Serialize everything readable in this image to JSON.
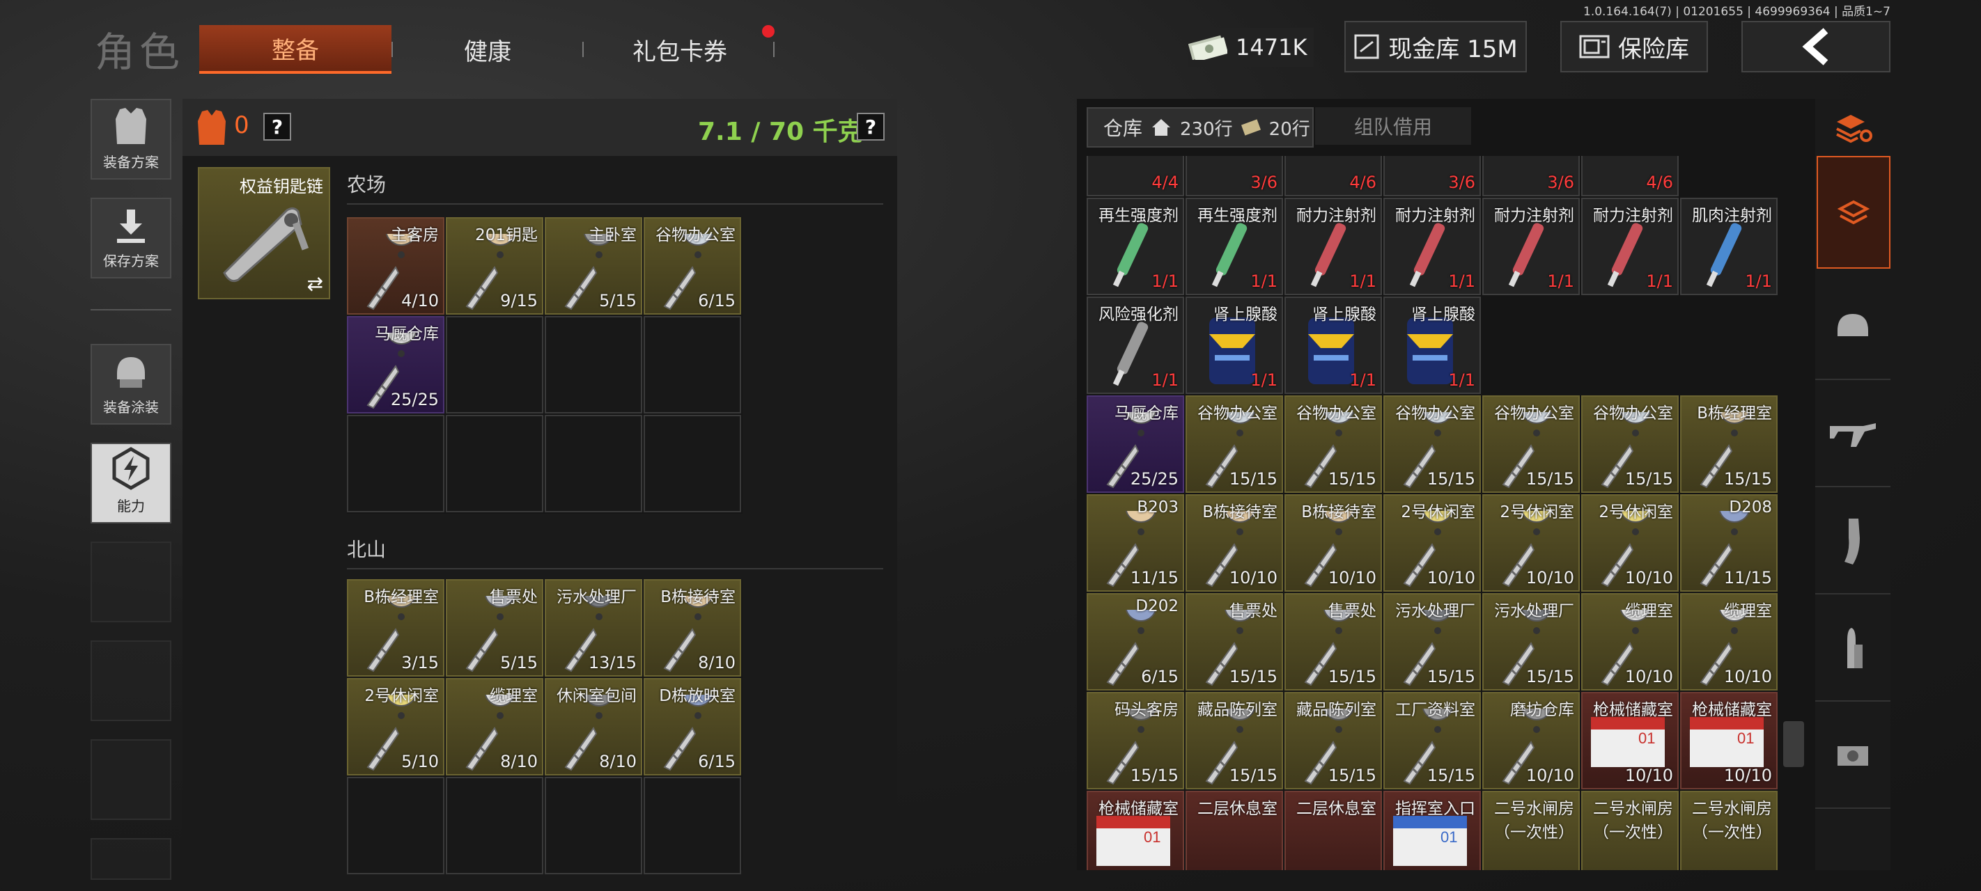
{
  "version": "1.0.164.164(7) | 01201655 | 4699969364 | 品质1~7",
  "page_title": "角色",
  "tabs": [
    {
      "label": "整备",
      "active": true
    },
    {
      "label": "健康",
      "active": false
    },
    {
      "label": "礼包卡券",
      "active": false,
      "badge": true
    }
  ],
  "top_bar": {
    "cash": "1471K",
    "vault_button": "现金库 15M",
    "safe_button": "保险库",
    "back_icon": "chevron-left-icon"
  },
  "left_rail": [
    {
      "label": "装备方案",
      "icon": "vest-icon"
    },
    {
      "label": "保存方案",
      "icon": "download-icon"
    },
    {
      "label": "装备涂装",
      "icon": "helmet-icon"
    },
    {
      "label": "能力",
      "icon": "lightning-icon",
      "active": true
    }
  ],
  "keychain": {
    "count": "0",
    "help": "?",
    "weight": "7.1 / 70 千克",
    "slot_label": "权益钥匙链",
    "swap_icon": "⇄"
  },
  "sections": [
    {
      "title": "农场",
      "items": [
        {
          "name": "主客房",
          "count": "4/10",
          "rarity": "brown",
          "color": "#e3c9a1"
        },
        {
          "name": "201钥匙",
          "count": "9/15",
          "rarity": "key",
          "color": "#e3c9a1"
        },
        {
          "name": "主卧室",
          "count": "5/15",
          "rarity": "key",
          "color": "#9a9a9a"
        },
        {
          "name": "谷物办公室",
          "count": "6/15",
          "rarity": "key",
          "color": "#cfd7de"
        },
        {
          "name": "马厩仓库",
          "count": "25/25",
          "rarity": "purple",
          "color": "#d8d8d8"
        }
      ]
    },
    {
      "title": "北山",
      "items": [
        {
          "name": "B栋经理室",
          "count": "3/15",
          "rarity": "key",
          "color": "#d8c4a0"
        },
        {
          "name": "售票处",
          "count": "5/15",
          "rarity": "key",
          "color": "#b9bcc2"
        },
        {
          "name": "污水处理厂",
          "count": "13/15",
          "rarity": "key",
          "color": "#7a7d82"
        },
        {
          "name": "B栋接待室",
          "count": "8/10",
          "rarity": "key",
          "color": "#e3c9a1"
        },
        {
          "name": "2号休闲室",
          "count": "5/10",
          "rarity": "key",
          "color": "#e8d87a"
        },
        {
          "name": "缆理室",
          "count": "8/10",
          "rarity": "key",
          "color": "#e0e0e0"
        },
        {
          "name": "休闲室包间",
          "count": "8/10",
          "rarity": "key",
          "color": "#8a8a8a"
        },
        {
          "name": "D栋放映室",
          "count": "6/15",
          "rarity": "key",
          "color": "#8fa0c8"
        }
      ]
    }
  ],
  "warehouse": {
    "tab_label": "仓库",
    "rows_total": "230行",
    "rows_extra": "20行",
    "team_tab": "组队借用",
    "rows": [
      [
        {
          "name": "",
          "count": "4/4",
          "rarity": "dark",
          "red": true,
          "kind": "bag"
        },
        {
          "name": "",
          "count": "3/6",
          "rarity": "dark",
          "red": true,
          "kind": "can"
        },
        {
          "name": "",
          "count": "4/6",
          "rarity": "dark",
          "red": true,
          "kind": "can"
        },
        {
          "name": "",
          "count": "3/6",
          "rarity": "dark",
          "red": true,
          "kind": "can"
        },
        {
          "name": "",
          "count": "3/6",
          "rarity": "dark",
          "red": true,
          "kind": "can"
        },
        {
          "name": "",
          "count": "4/6",
          "rarity": "dark",
          "red": true,
          "kind": "can"
        }
      ],
      [
        {
          "name": "再生强度剂",
          "count": "1/1",
          "rarity": "dark",
          "red": true,
          "kind": "syringe",
          "color": "#5fb87a"
        },
        {
          "name": "再生强度剂",
          "count": "1/1",
          "rarity": "dark",
          "red": true,
          "kind": "syringe",
          "color": "#5fb87a"
        },
        {
          "name": "耐力注射剂",
          "count": "1/1",
          "rarity": "dark",
          "red": true,
          "kind": "syringe",
          "color": "#c8525a"
        },
        {
          "name": "耐力注射剂",
          "count": "1/1",
          "rarity": "dark",
          "red": true,
          "kind": "syringe",
          "color": "#c8525a"
        },
        {
          "name": "耐力注射剂",
          "count": "1/1",
          "rarity": "dark",
          "red": true,
          "kind": "syringe",
          "color": "#c8525a"
        },
        {
          "name": "耐力注射剂",
          "count": "1/1",
          "rarity": "dark",
          "red": true,
          "kind": "syringe",
          "color": "#c8525a"
        },
        {
          "name": "肌肉注射剂",
          "count": "1/1",
          "rarity": "dark",
          "red": true,
          "kind": "syringe",
          "color": "#4a8ad0"
        }
      ],
      [
        {
          "name": "风险强化剂",
          "count": "1/1",
          "rarity": "dark",
          "red": true,
          "kind": "syringe",
          "color": "#999"
        },
        {
          "name": "肾上腺酸",
          "count": "1/1",
          "rarity": "dark",
          "red": true,
          "kind": "canblue"
        },
        {
          "name": "肾上腺酸",
          "count": "1/1",
          "rarity": "dark",
          "red": true,
          "kind": "canblue"
        },
        {
          "name": "肾上腺酸",
          "count": "1/1",
          "rarity": "dark",
          "red": true,
          "kind": "canblue"
        }
      ],
      [
        {
          "name": "马厩仓库",
          "count": "25/25",
          "rarity": "purple",
          "kind": "key",
          "color": "#d8d8d8"
        },
        {
          "name": "谷物办公室",
          "count": "15/15",
          "rarity": "key",
          "kind": "key",
          "color": "#cfd7de"
        },
        {
          "name": "谷物办公室",
          "count": "15/15",
          "rarity": "key",
          "kind": "key",
          "color": "#cfd7de"
        },
        {
          "name": "谷物办公室",
          "count": "15/15",
          "rarity": "key",
          "kind": "key",
          "color": "#cfd7de"
        },
        {
          "name": "谷物办公室",
          "count": "15/15",
          "rarity": "key",
          "kind": "key",
          "color": "#cfd7de"
        },
        {
          "name": "谷物办公室",
          "count": "15/15",
          "rarity": "key",
          "kind": "key",
          "color": "#cfd7de"
        },
        {
          "name": "B栋经理室",
          "count": "15/15",
          "rarity": "key",
          "kind": "key",
          "color": "#d8c4a0"
        }
      ],
      [
        {
          "name": "B203",
          "count": "11/15",
          "rarity": "key",
          "kind": "key",
          "color": "#e3c9a1"
        },
        {
          "name": "B栋接待室",
          "count": "10/10",
          "rarity": "key",
          "kind": "key",
          "color": "#e3c9a1"
        },
        {
          "name": "B栋接待室",
          "count": "10/10",
          "rarity": "key",
          "kind": "key",
          "color": "#e3c9a1"
        },
        {
          "name": "2号休闲室",
          "count": "10/10",
          "rarity": "key",
          "kind": "key",
          "color": "#e8d87a"
        },
        {
          "name": "2号休闲室",
          "count": "10/10",
          "rarity": "key",
          "kind": "key",
          "color": "#e8d87a"
        },
        {
          "name": "2号休闲室",
          "count": "10/10",
          "rarity": "key",
          "kind": "key",
          "color": "#e8d87a"
        },
        {
          "name": "D208",
          "count": "11/15",
          "rarity": "key",
          "kind": "key",
          "color": "#8fa0c8"
        }
      ],
      [
        {
          "name": "D202",
          "count": "6/15",
          "rarity": "key",
          "kind": "key",
          "color": "#8fa0c8"
        },
        {
          "name": "售票处",
          "count": "15/15",
          "rarity": "key",
          "kind": "key",
          "color": "#b9bcc2"
        },
        {
          "name": "售票处",
          "count": "15/15",
          "rarity": "key",
          "kind": "key",
          "color": "#b9bcc2"
        },
        {
          "name": "污水处理厂",
          "count": "15/15",
          "rarity": "key",
          "kind": "key",
          "color": "#7a7d82"
        },
        {
          "name": "污水处理厂",
          "count": "15/15",
          "rarity": "key",
          "kind": "key",
          "color": "#7a7d82"
        },
        {
          "name": "缆理室",
          "count": "10/10",
          "rarity": "key",
          "kind": "key",
          "color": "#e0e0e0"
        },
        {
          "name": "缆理室",
          "count": "10/10",
          "rarity": "key",
          "kind": "key",
          "color": "#e0e0e0"
        }
      ],
      [
        {
          "name": "码头客房",
          "count": "15/15",
          "rarity": "key",
          "kind": "key",
          "color": "#8a8a8a"
        },
        {
          "name": "藏品陈列室",
          "count": "15/15",
          "rarity": "key",
          "kind": "key",
          "color": "#9a9a9a"
        },
        {
          "name": "藏品陈列室",
          "count": "15/15",
          "rarity": "key",
          "kind": "key",
          "color": "#9a9a9a"
        },
        {
          "name": "工厂资料室",
          "count": "15/15",
          "rarity": "key",
          "kind": "key",
          "color": "#9a9a9a"
        },
        {
          "name": "磨坊仓库",
          "count": "10/10",
          "rarity": "key",
          "kind": "key",
          "color": "#9a9a9a"
        },
        {
          "name": "枪械储藏室",
          "count": "10/10",
          "rarity": "red",
          "kind": "card",
          "color": "#c8302c"
        },
        {
          "name": "枪械储藏室",
          "count": "10/10",
          "rarity": "red",
          "kind": "card",
          "color": "#c8302c"
        }
      ],
      [
        {
          "name": "枪械储藏室",
          "count": "",
          "rarity": "red",
          "kind": "card",
          "color": "#c8302c"
        },
        {
          "name": "二层休息室",
          "count": "",
          "rarity": "red",
          "kind": "none"
        },
        {
          "name": "二层休息室",
          "count": "",
          "rarity": "red",
          "kind": "none"
        },
        {
          "name": "指挥室入口",
          "count": "",
          "rarity": "red",
          "kind": "card",
          "color": "#3a6ac8"
        },
        {
          "name": "二号水闸房\n（一次性）",
          "count": "",
          "rarity": "key",
          "kind": "none"
        },
        {
          "name": "二号水闸房\n（一次性）",
          "count": "",
          "rarity": "key",
          "kind": "none"
        },
        {
          "name": "二号水闸房\n（一次性）",
          "count": "",
          "rarity": "key",
          "kind": "none"
        }
      ]
    ]
  },
  "right_rail_icons": [
    "stack-refresh-icon",
    "stack-icon",
    "helmet-icon",
    "rifle-icon",
    "magazine-icon",
    "ammo-icon",
    "scope-icon"
  ]
}
